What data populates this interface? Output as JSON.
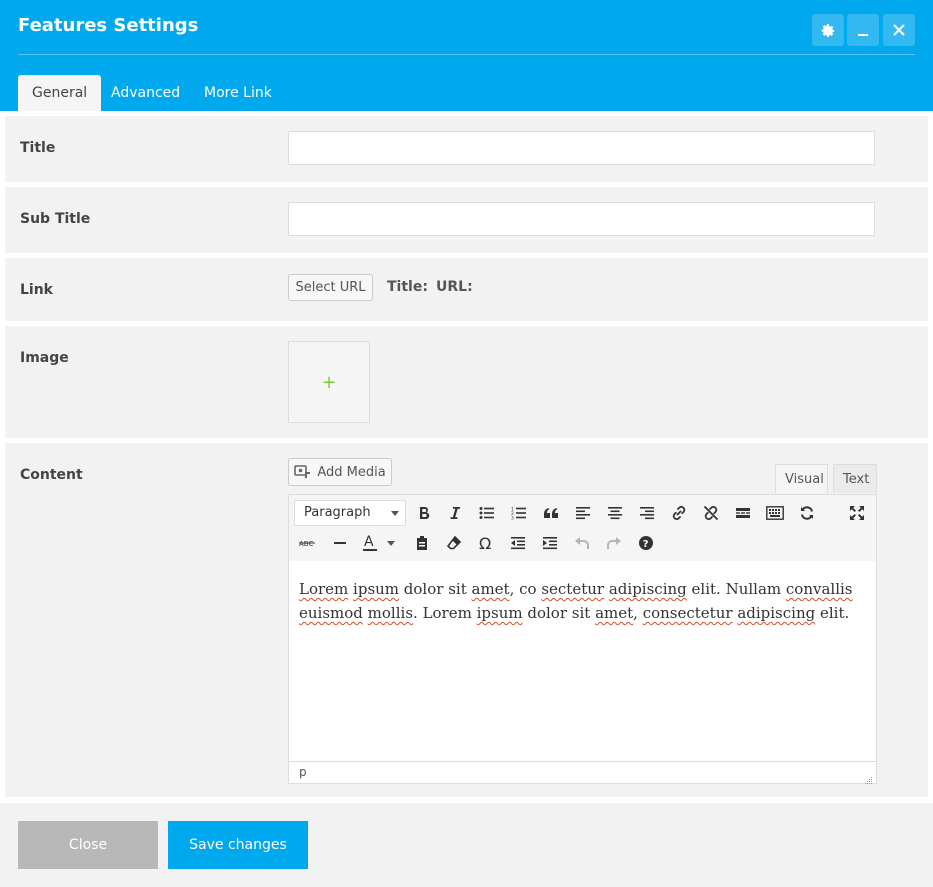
{
  "dialog": {
    "title": "Features Settings",
    "colors": {
      "header": "#00a9ed",
      "accent": "#00a9ed",
      "close_button": "#b8b8b8"
    },
    "header_buttons": [
      "gear-icon",
      "minimize-icon",
      "close-icon"
    ]
  },
  "tabs": [
    {
      "label": "General",
      "active": true
    },
    {
      "label": "Advanced",
      "active": false
    },
    {
      "label": "More Link",
      "active": false
    }
  ],
  "fields": {
    "title": {
      "label": "Title",
      "value": ""
    },
    "subtitle": {
      "label": "Sub Title",
      "value": ""
    },
    "link": {
      "label": "Link",
      "button_label": "Select URL",
      "title_label": "Title:",
      "url_label": "URL:"
    },
    "image": {
      "label": "Image",
      "add_icon": "+"
    },
    "content": {
      "label": "Content",
      "add_media_label": "Add Media",
      "visual_tab": "Visual",
      "text_tab": "Text",
      "format_select": "Paragraph",
      "body_line1": [
        "Lorem",
        " ",
        "ipsum",
        " dolor sit ",
        "amet",
        ", co ",
        "sectetur",
        " ",
        "adipiscing",
        " elit. Nullam ",
        "convallis"
      ],
      "body_line2": [
        "euismod",
        " ",
        "mollis",
        ". Lorem ",
        "ipsum",
        " dolor sit ",
        "amet",
        ", ",
        "consectetur",
        " ",
        "adipiscing",
        " elit."
      ],
      "status_path": "p"
    }
  },
  "footer": {
    "close_label": "Close",
    "save_label": "Save changes"
  }
}
